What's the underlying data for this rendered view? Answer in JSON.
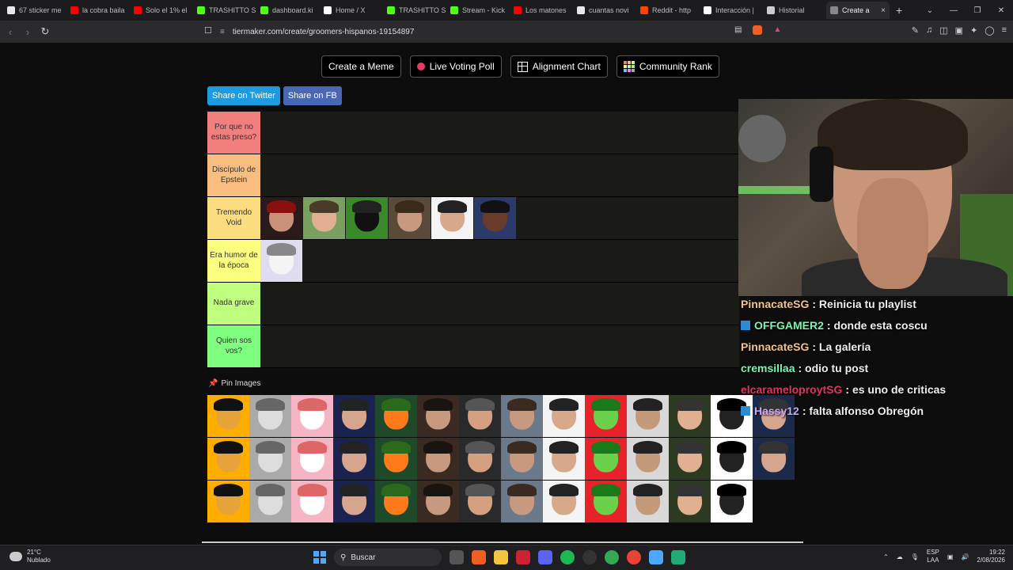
{
  "browser": {
    "tabs": [
      {
        "label": "67 sticker me",
        "color": "#e8e8e8"
      },
      {
        "label": "la cobra baila",
        "color": "#ff0000"
      },
      {
        "label": "Solo el 1% el",
        "color": "#ff0000"
      },
      {
        "label": "TRASHITTO S",
        "color": "#53fc18"
      },
      {
        "label": "dashboard.ki",
        "color": "#53fc18"
      },
      {
        "label": "Home / X",
        "color": "#ffffff"
      },
      {
        "label": "TRASHITTO S",
        "color": "#53fc18"
      },
      {
        "label": "Stream - Kick",
        "color": "#53fc18"
      },
      {
        "label": "Los matones",
        "color": "#ff0000"
      },
      {
        "label": "cuantas novi",
        "color": "#e8e8e8"
      },
      {
        "label": "Reddit - http",
        "color": "#ff4500"
      },
      {
        "label": "Interacción |",
        "color": "#ffffff"
      },
      {
        "label": "Historial",
        "color": "#cccccc"
      },
      {
        "label": "Create a",
        "color": "#888888"
      }
    ],
    "active_tab_index": 13,
    "new_tab": "+",
    "url": "tiermaker.com/create/groomers-hispanos-19154897"
  },
  "page": {
    "top_buttons": {
      "create_meme": "Create a Meme",
      "live_poll": "Live Voting Poll",
      "alignment": "Alignment Chart",
      "community": "Community Rank"
    },
    "share": {
      "twitter": "Share on Twitter",
      "fb": "Share on FB"
    },
    "tiers": [
      {
        "label": "Por que no estas preso?",
        "color": "#f27f7e"
      },
      {
        "label": "Discípulo de Epstein",
        "color": "#f9be7f"
      },
      {
        "label": "Tremendo Void",
        "color": "#fbdd80"
      },
      {
        "label": "Era humor de la época",
        "color": "#fbfe7f"
      },
      {
        "label": "Nada grave",
        "color": "#bffe7f"
      },
      {
        "label": "Quien sos vos?",
        "color": "#7ffe7f"
      }
    ],
    "pin_images": "Pin Images"
  },
  "chat": [
    {
      "user": "PinnacateSG",
      "text": ": Reinicia tu playlist",
      "color": "#f2c38a",
      "badge": false
    },
    {
      "user": "OFFGAMER2",
      "text": ": donde esta coscu",
      "color": "#7cf5b0",
      "badge": true
    },
    {
      "user": "PinnacateSG",
      "text": ": La galería",
      "color": "#f2c38a",
      "badge": false
    },
    {
      "user": "cremsillaa",
      "text": ": odio tu post",
      "color": "#7cf5b0",
      "badge": false
    },
    {
      "user": "elcarameloproytSG",
      "text": ": es uno de criticas",
      "color": "#e0355f",
      "badge": false
    },
    {
      "user": "Hassy12",
      "text": ": falta alfonso Obregón",
      "color": "#c9a7f5",
      "badge": true
    }
  ],
  "taskbar": {
    "temp": "21°C",
    "weather": "Nublado",
    "search": "Buscar",
    "lang1": "ESP",
    "lang2": "LAA",
    "time": "19:22",
    "date": "2/08/2026"
  }
}
